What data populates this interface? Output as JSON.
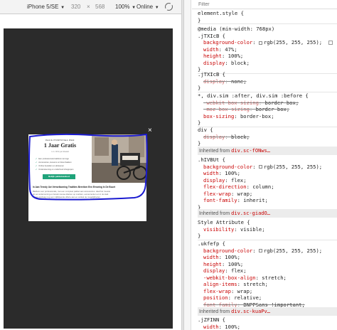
{
  "toolbar": {
    "device": "iPhone 5/SE",
    "width": "320",
    "times": "×",
    "height": "568",
    "zoom": "100%",
    "network": "Online"
  },
  "popup": {
    "close": "×",
    "brand_small": "PACK ESSENTIAL PRO",
    "title": "1 Jaar Gratis",
    "subtitle": "t.t.v. 60 € per maand",
    "checks": [
      "Een professionele bakfiets met logo",
      "Accessoires, kussens en bloembakken",
      "Online bestellen en afrekenen",
      "Ondersteuning en onderhoud inbegrepen"
    ],
    "button": "Bekijk pakketaanbod",
    "body_head": "In Aan Trendy Uw Verwelkoming Tradities Bereiken Een Ervaring In De Buurt",
    "body_lines": [
      "Bakfiets voor professionals, met een compleet pakket aan accessoires. Haal het meeste",
      "uit uw onderneming en bereik nieuwe klanten op markten, evenementen en in de stad.",
      "Vraag vandaag nog een vrijblijvende offerte aan en ontdek de mogelijkheden."
    ]
  },
  "styles": {
    "filter_placeholder": "Filter",
    "rules": [
      {
        "selector": "element.style {",
        "props": [],
        "close": "}"
      },
      {
        "selector": "@media (min-width: 768px)",
        "selector2": ".jTXIcB {",
        "props": [
          {
            "name": "background-color",
            "value": "rgb(255, 255, 255);",
            "swatch": true
          },
          {
            "name": "width",
            "value": "47%;"
          },
          {
            "name": "height",
            "value": "100%;"
          },
          {
            "name": "display",
            "value": "block;"
          }
        ],
        "close": "}"
      },
      {
        "selector": ".jTXIcB {",
        "props": [
          {
            "name": "display",
            "value": "none;",
            "struck": true
          }
        ],
        "close": "}"
      },
      {
        "selector": "*, div.sim :after, div.sim :before {",
        "props": [
          {
            "name": "-webkit-box-sizing",
            "value": "border-box;",
            "struck": true
          },
          {
            "name": "-moz-box-sizing",
            "value": "border-box;",
            "struck": true
          },
          {
            "name": "box-sizing",
            "value": "border-box;"
          }
        ],
        "close": "}"
      },
      {
        "selector": "div {",
        "props": [
          {
            "name": "display",
            "value": "block;",
            "struck": true
          }
        ],
        "close": "}"
      }
    ],
    "inherited_1": {
      "label": "Inherited from ",
      "source": "div.sc-fONws…"
    },
    "rule_hivbut": {
      "selector": ".hIVBUt {",
      "props": [
        {
          "name": "background-color",
          "value": "rgb(255, 255, 255);",
          "swatch": true
        },
        {
          "name": "width",
          "value": "100%;"
        },
        {
          "name": "display",
          "value": "flex;"
        },
        {
          "name": "flex-direction",
          "value": "column;"
        },
        {
          "name": "flex-wrap",
          "value": "wrap;"
        },
        {
          "name": "font-family",
          "value": "inherit;"
        }
      ],
      "close": "}"
    },
    "inherited_2": {
      "label": "Inherited from ",
      "source": "div.sc-giadO…"
    },
    "rule_style_attr": {
      "selector": "Style Attribute {",
      "props": [
        {
          "name": "visibility",
          "value": "visible;"
        }
      ],
      "close": "}"
    },
    "rule_ukfefp": {
      "selector": ".ukfefp {",
      "props": [
        {
          "name": "background-color",
          "value": "rgb(255, 255, 255);",
          "swatch": true
        },
        {
          "name": "width",
          "value": "100%;"
        },
        {
          "name": "height",
          "value": "100%;"
        },
        {
          "name": "display",
          "value": "flex;"
        },
        {
          "name": "-webkit-box-align",
          "value": "stretch;"
        },
        {
          "name": "align-items",
          "value": "stretch;"
        },
        {
          "name": "flex-wrap",
          "value": "wrap;"
        },
        {
          "name": "position",
          "value": "relative;"
        },
        {
          "name": "font-family",
          "value": "BNPPSans !important;",
          "struck": true
        }
      ],
      "close": "}"
    },
    "inherited_3": {
      "label": "Inherited from ",
      "source": "div.sc-kuaPv…"
    },
    "rule_jzfinn": {
      "selector": ".jZFINN {",
      "props": [
        {
          "name": "width",
          "value": "100%;"
        }
      ]
    }
  }
}
